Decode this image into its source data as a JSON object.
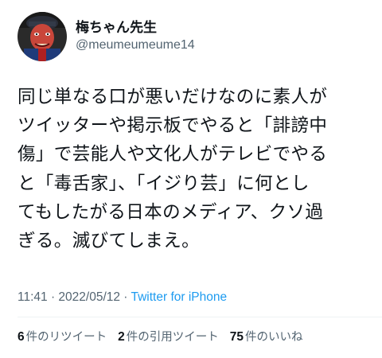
{
  "user": {
    "display_name": "梅ちゃん先生",
    "handle": "@meumeumeume14"
  },
  "tweet": {
    "lines": [
      "同じ単なる口が悪いだけなのに素人が",
      "ツイッターや掲示板でやると「誹謗中",
      "傷」で芸能人や文化人がテレビでやる",
      "と「毒舌家」、「イジり芸」に何とし",
      "てもしたがる日本のメディア、クソ過",
      "ぎる。滅びてしまえ。"
    ]
  },
  "meta": {
    "time": "11:41",
    "separator1": " · ",
    "date": "2022/05/12",
    "separator2": " · ",
    "source": "Twitter for iPhone"
  },
  "stats": {
    "retweets_count": "6",
    "retweets_label": "件のリツイート",
    "quotes_count": "2",
    "quotes_label": "件の引用ツイート",
    "likes_count": "75",
    "likes_label": "件のいいね"
  },
  "colors": {
    "text": "#0f1419",
    "secondary": "#536471",
    "link": "#1d9bf0"
  }
}
